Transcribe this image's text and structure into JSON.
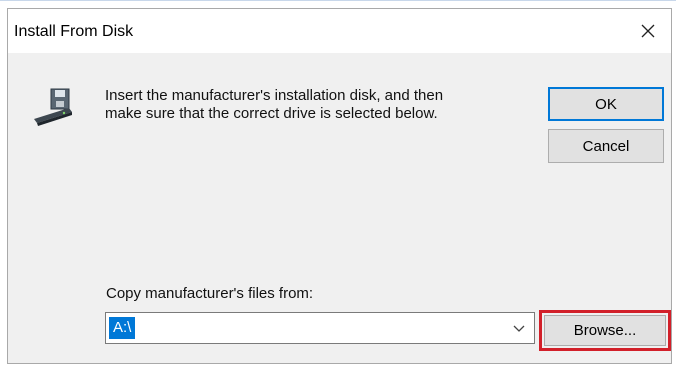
{
  "dialog": {
    "title": "Install From Disk",
    "close_icon": "close-icon"
  },
  "icons": {
    "disk": "disk-drive-icon",
    "dropdown": "chevron-down-icon"
  },
  "message": {
    "line1": "Insert the manufacturer's installation disk, and then",
    "line2": "make sure that the correct drive is selected below."
  },
  "buttons": {
    "ok": "OK",
    "cancel": "Cancel",
    "browse": "Browse..."
  },
  "copy_from": {
    "label": "Copy manufacturer's files from:",
    "value": "A:\\"
  },
  "colors": {
    "highlight": "#d2202a",
    "selection": "#0078d7",
    "dialog_bg": "#f0f0f0"
  }
}
